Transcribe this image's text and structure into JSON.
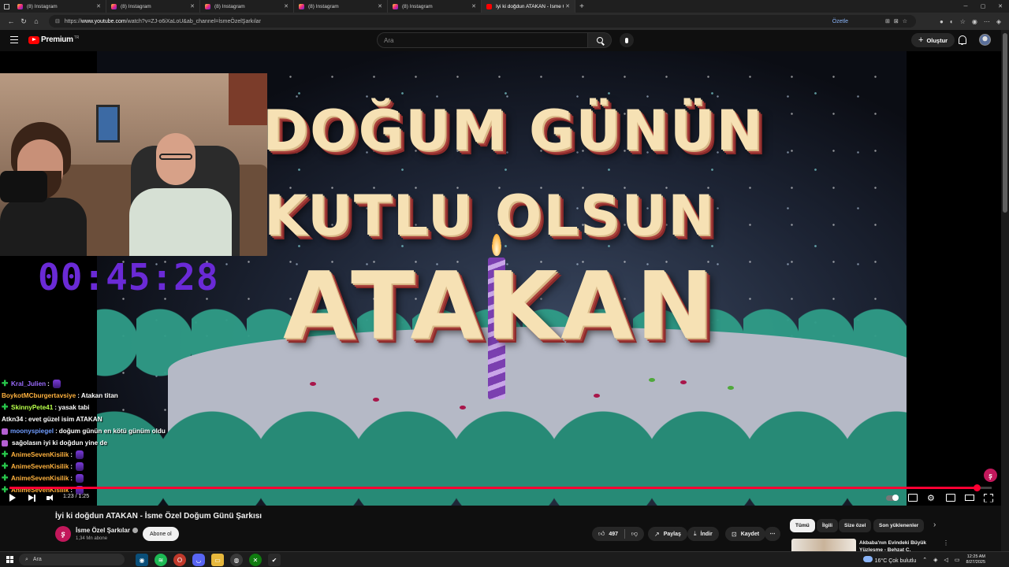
{
  "browser": {
    "tabs": [
      {
        "title": "(8) Instagram"
      },
      {
        "title": "(8) Instagram"
      },
      {
        "title": "(8) Instagram"
      },
      {
        "title": "(8) Instagram"
      },
      {
        "title": "(8) Instagram"
      },
      {
        "title": "İyi ki doğdun ATAKAN - İsme Öz..."
      }
    ],
    "url_prefix": "https://",
    "url_host": "www.youtube.com",
    "url_path": "/watch?v=ZJ-o6iXaLoU&ab_channel=İsmeÖzelŞarkılar",
    "summarize_label": "Özetle"
  },
  "masthead": {
    "brand": "Premium",
    "region": "TR",
    "search_placeholder": "Ara",
    "create_label": "Oluştur"
  },
  "video_frame": {
    "line1": "DOĞUM GÜNÜN",
    "line2": "KUTLU OLSUN",
    "line3": "ATAKAN"
  },
  "overlay": {
    "timer": "00:45:28",
    "chat": [
      {
        "badge": "plus",
        "user": "Kral_Julien",
        "user_color": "#9b6cff",
        "msg": "",
        "emote": true
      },
      {
        "badge": "none",
        "user": "BoykotMCburgertavsiye",
        "user_color": "#ffb23e",
        "msg": "Atakan titan",
        "emote": false
      },
      {
        "badge": "plus",
        "user": "SkinnyPete41",
        "user_color": "#b8ff4a",
        "msg": "yasak tabi",
        "emote": false
      },
      {
        "badge": "none",
        "user": "Atkn34",
        "user_color": "#ffffff",
        "msg": "evet güzel isim ATAKAN",
        "emote": false
      },
      {
        "badge": "emo",
        "user": "moonyspiegel",
        "user_color": "#6f9cff",
        "msg": "doğum günün en kötü günüm oldu",
        "emote": false
      },
      {
        "badge": "emo",
        "user": "",
        "user_color": "#ffffff",
        "msg": "sağolasın iyi ki doğdun yine de",
        "emote": false
      },
      {
        "badge": "plus",
        "user": "AnimeSevenKisilik",
        "user_color": "#ffb23e",
        "msg": "",
        "emote": true
      },
      {
        "badge": "plus",
        "user": "AnimeSevenKisilik",
        "user_color": "#ffb23e",
        "msg": "",
        "emote": true
      },
      {
        "badge": "plus",
        "user": "AnimeSevenKisilik",
        "user_color": "#ffb23e",
        "msg": "",
        "emote": true
      },
      {
        "badge": "plus",
        "user": "AnimeSevenKisilik",
        "user_color": "#ffb23e",
        "msg": "",
        "emote": true
      }
    ]
  },
  "player": {
    "current_time": "1:23",
    "duration": "1:25",
    "timecode": "1:23 / 1:25",
    "progress": 0.985,
    "accent": "#ff0033"
  },
  "video": {
    "title": "İyi ki doğdun ATAKAN - İsme Özel Doğum Günü Şarkısı",
    "channel": "İsme Özel Şarkılar",
    "subscribers": "1,34 Mn abone",
    "subscribe_label": "Abone ol",
    "likes": "497",
    "share_label": "Paylaş",
    "download_label": "İndir",
    "save_label": "Kaydet"
  },
  "chips": [
    {
      "label": "Tümü",
      "active": true
    },
    {
      "label": "İlgili",
      "active": false
    },
    {
      "label": "Size özel",
      "active": false
    },
    {
      "label": "Son yüklenenler",
      "active": false
    }
  ],
  "recommendation": {
    "title": "Akbaba'nın Evindeki Büyük Yüzleşme - Behzat Ç."
  },
  "taskbar": {
    "search_placeholder": "Ara",
    "temperature": "16°C",
    "weather": "Çok bulutlu",
    "time": "12:25 AM",
    "date": "8/27/2025"
  }
}
